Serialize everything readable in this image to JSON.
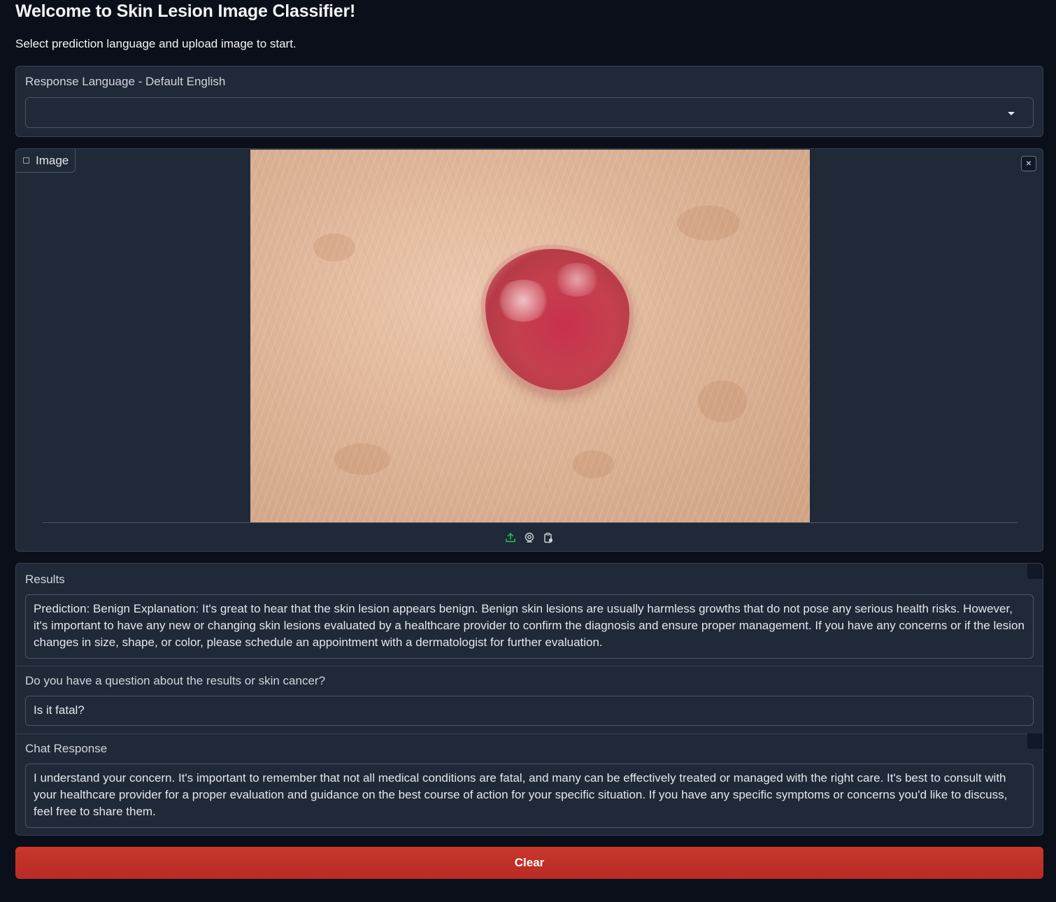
{
  "header": {
    "title": "Welcome to Skin Lesion Image Classifier!",
    "subtitle": "Select prediction language and upload image to start."
  },
  "language": {
    "label": "Response Language - Default English",
    "selected_value": ""
  },
  "image": {
    "label": "Image",
    "close_symbol": "×",
    "tool_icons": [
      "upload-icon",
      "webcam-icon",
      "clipboard-icon"
    ]
  },
  "results": {
    "label": "Results",
    "text": "Prediction: Benign Explanation: It's great to hear that the skin lesion appears benign. Benign skin lesions are usually harmless growths that do not pose any serious health risks. However, it's important to have any new or changing skin lesions evaluated by a healthcare provider to confirm the diagnosis and ensure proper management. If you have any concerns or if the lesion changes in size, shape, or color, please schedule an appointment with a dermatologist for further evaluation."
  },
  "question": {
    "label": "Do you have a question about the results or skin cancer?",
    "value": "Is it fatal?"
  },
  "chat": {
    "label": "Chat Response",
    "text": "I understand your concern. It's important to remember that not all medical conditions are fatal, and many can be effectively treated or managed with the right care. It's best to consult with your healthcare provider for a proper evaluation and guidance on the best course of action for your specific situation. If you have any specific symptoms or concerns you'd like to discuss, feel free to share them."
  },
  "actions": {
    "clear_label": "Clear"
  },
  "colors": {
    "background": "#0b0f19",
    "panel": "#1f2937",
    "clear_button": "#c0322a",
    "upload_icon": "#22c55e"
  }
}
